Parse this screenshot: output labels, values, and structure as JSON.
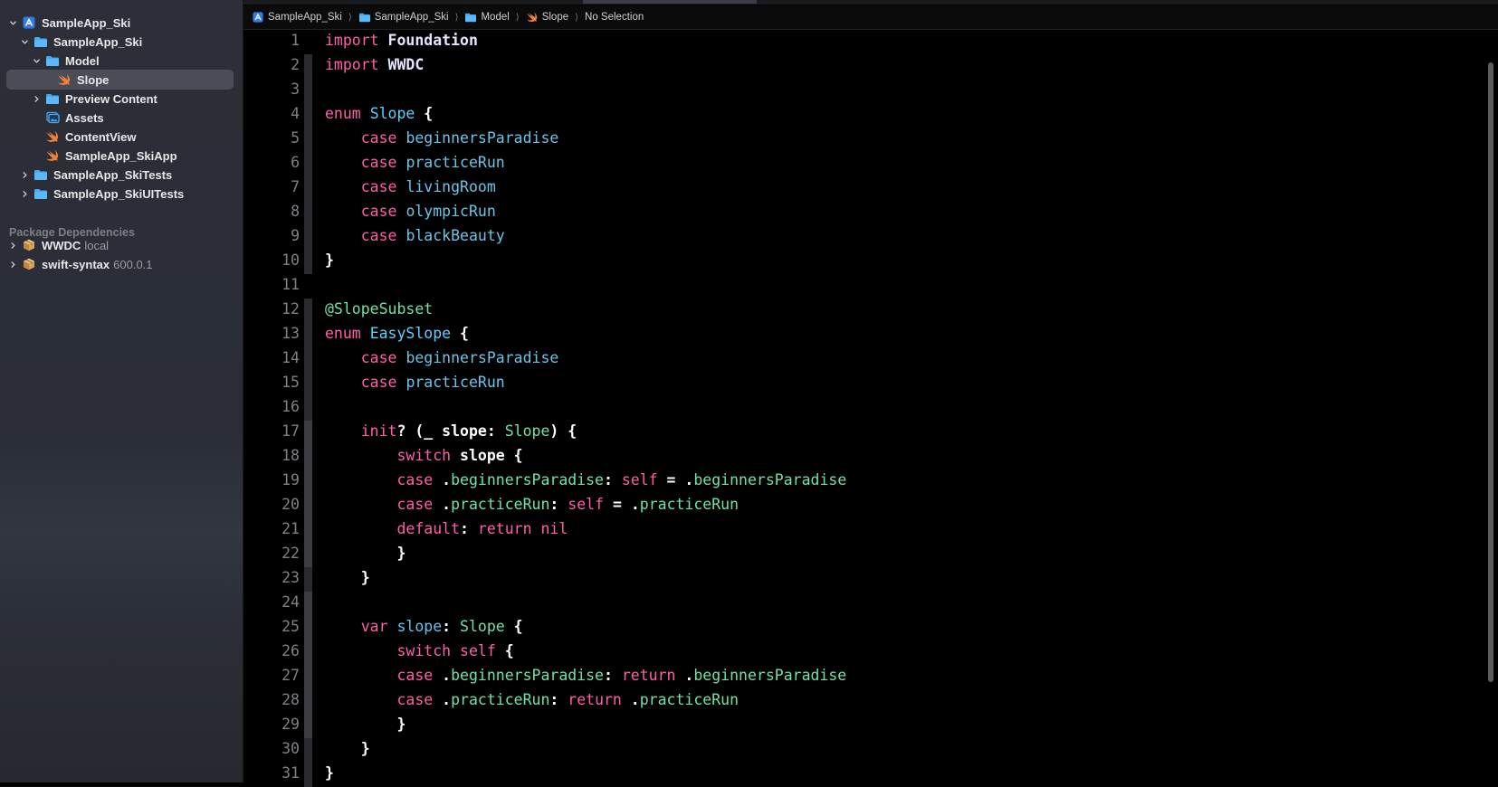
{
  "breadcrumb": {
    "items": [
      {
        "label": "SampleApp_Ski",
        "icon": "xcode-project-icon"
      },
      {
        "label": "SampleApp_Ski",
        "icon": "folder-icon"
      },
      {
        "label": "Model",
        "icon": "folder-icon"
      },
      {
        "label": "Slope",
        "icon": "swift-file-icon"
      },
      {
        "label": "No Selection",
        "icon": ""
      }
    ]
  },
  "navigator": {
    "tree": [
      {
        "label": "SampleApp_Ski",
        "icon": "xcode-project-icon",
        "disclosure": "expanded"
      },
      {
        "label": "SampleApp_Ski",
        "icon": "folder-icon",
        "disclosure": "expanded"
      },
      {
        "label": "Model",
        "icon": "folder-icon",
        "disclosure": "expanded"
      },
      {
        "label": "Slope",
        "icon": "swift-file-icon",
        "disclosure": "none",
        "selected": true
      },
      {
        "label": "Preview Content",
        "icon": "folder-icon",
        "disclosure": "collapsed"
      },
      {
        "label": "Assets",
        "icon": "asset-catalog-icon",
        "disclosure": "none"
      },
      {
        "label": "ContentView",
        "icon": "swift-file-icon",
        "disclosure": "none"
      },
      {
        "label": "SampleApp_SkiApp",
        "icon": "swift-file-icon",
        "disclosure": "none"
      },
      {
        "label": "SampleApp_SkiTests",
        "icon": "folder-icon",
        "disclosure": "collapsed"
      },
      {
        "label": "SampleApp_SkiUITests",
        "icon": "folder-icon",
        "disclosure": "collapsed"
      }
    ],
    "package_header": "Package Dependencies",
    "packages": [
      {
        "label": "WWDC",
        "detail": "local",
        "icon": "package-icon"
      },
      {
        "label": "swift-syntax",
        "detail": "600.0.1",
        "icon": "package-icon"
      }
    ]
  },
  "editor": {
    "line_numbers": [
      "1",
      "2",
      "3",
      "4",
      "5",
      "6",
      "7",
      "8",
      "9",
      "10",
      "11",
      "12",
      "13",
      "14",
      "15",
      "16",
      "17",
      "18",
      "19",
      "20",
      "21",
      "22",
      "23",
      "24",
      "25",
      "26",
      "27",
      "28",
      "29",
      "30",
      "31"
    ],
    "colors": {
      "keyword": "#ff5fa8",
      "type": "#5ed1ff",
      "member": "#6bc4e8",
      "attribute": "#6fe3a8"
    },
    "lines": [
      [
        {
          "t": "import",
          "c": "kw"
        },
        {
          "t": " "
        },
        {
          "t": "Foundation",
          "c": "lib"
        }
      ],
      [
        {
          "t": "import",
          "c": "kw"
        },
        {
          "t": " "
        },
        {
          "t": "WWDC",
          "c": "lib"
        }
      ],
      [],
      [
        {
          "t": "enum",
          "c": "kw"
        },
        {
          "t": " "
        },
        {
          "t": "Slope",
          "c": "ty"
        },
        {
          "t": " {"
        }
      ],
      [
        {
          "t": "    "
        },
        {
          "t": "case",
          "c": "kw"
        },
        {
          "t": " "
        },
        {
          "t": "beginnersParadise",
          "c": "mem"
        }
      ],
      [
        {
          "t": "    "
        },
        {
          "t": "case",
          "c": "kw"
        },
        {
          "t": " "
        },
        {
          "t": "practiceRun",
          "c": "mem"
        }
      ],
      [
        {
          "t": "    "
        },
        {
          "t": "case",
          "c": "kw"
        },
        {
          "t": " "
        },
        {
          "t": "livingRoom",
          "c": "mem"
        }
      ],
      [
        {
          "t": "    "
        },
        {
          "t": "case",
          "c": "kw"
        },
        {
          "t": " "
        },
        {
          "t": "olympicRun",
          "c": "mem"
        }
      ],
      [
        {
          "t": "    "
        },
        {
          "t": "case",
          "c": "kw"
        },
        {
          "t": " "
        },
        {
          "t": "blackBeauty",
          "c": "mem"
        }
      ],
      [
        {
          "t": "}"
        }
      ],
      [],
      [
        {
          "t": "@SlopeSubset",
          "c": "attr"
        }
      ],
      [
        {
          "t": "enum",
          "c": "kw"
        },
        {
          "t": " "
        },
        {
          "t": "EasySlope",
          "c": "ty"
        },
        {
          "t": " {"
        }
      ],
      [
        {
          "t": "    "
        },
        {
          "t": "case",
          "c": "kw"
        },
        {
          "t": " "
        },
        {
          "t": "beginnersParadise",
          "c": "mem"
        }
      ],
      [
        {
          "t": "    "
        },
        {
          "t": "case",
          "c": "kw"
        },
        {
          "t": " "
        },
        {
          "t": "practiceRun",
          "c": "mem"
        }
      ],
      [],
      [
        {
          "t": "    "
        },
        {
          "t": "init",
          "c": "kw"
        },
        {
          "t": "? (_ slope: "
        },
        {
          "t": "Slope",
          "c": "grn"
        },
        {
          "t": ") {"
        }
      ],
      [
        {
          "t": "        "
        },
        {
          "t": "switch",
          "c": "kw"
        },
        {
          "t": " slope {"
        }
      ],
      [
        {
          "t": "        "
        },
        {
          "t": "case",
          "c": "kw"
        },
        {
          "t": " ."
        },
        {
          "t": "beginnersParadise",
          "c": "grn"
        },
        {
          "t": ": "
        },
        {
          "t": "self",
          "c": "kw"
        },
        {
          "t": " = ."
        },
        {
          "t": "beginnersParadise",
          "c": "grn"
        }
      ],
      [
        {
          "t": "        "
        },
        {
          "t": "case",
          "c": "kw"
        },
        {
          "t": " ."
        },
        {
          "t": "practiceRun",
          "c": "grn"
        },
        {
          "t": ": "
        },
        {
          "t": "self",
          "c": "kw"
        },
        {
          "t": " = ."
        },
        {
          "t": "practiceRun",
          "c": "grn"
        }
      ],
      [
        {
          "t": "        "
        },
        {
          "t": "default",
          "c": "kw"
        },
        {
          "t": ": "
        },
        {
          "t": "return",
          "c": "kw"
        },
        {
          "t": " "
        },
        {
          "t": "nil",
          "c": "kw"
        }
      ],
      [
        {
          "t": "        }"
        }
      ],
      [
        {
          "t": "    }"
        }
      ],
      [],
      [
        {
          "t": "    "
        },
        {
          "t": "var",
          "c": "kw"
        },
        {
          "t": " "
        },
        {
          "t": "slope",
          "c": "mem"
        },
        {
          "t": ": "
        },
        {
          "t": "Slope",
          "c": "grn"
        },
        {
          "t": " {"
        }
      ],
      [
        {
          "t": "        "
        },
        {
          "t": "switch",
          "c": "kw"
        },
        {
          "t": " "
        },
        {
          "t": "self",
          "c": "kw"
        },
        {
          "t": " {"
        }
      ],
      [
        {
          "t": "        "
        },
        {
          "t": "case",
          "c": "kw"
        },
        {
          "t": " ."
        },
        {
          "t": "beginnersParadise",
          "c": "grn"
        },
        {
          "t": ": "
        },
        {
          "t": "return",
          "c": "kw"
        },
        {
          "t": " ."
        },
        {
          "t": "beginnersParadise",
          "c": "grn"
        }
      ],
      [
        {
          "t": "        "
        },
        {
          "t": "case",
          "c": "kw"
        },
        {
          "t": " ."
        },
        {
          "t": "practiceRun",
          "c": "grn"
        },
        {
          "t": ": "
        },
        {
          "t": "return",
          "c": "kw"
        },
        {
          "t": " ."
        },
        {
          "t": "practiceRun",
          "c": "grn"
        }
      ],
      [
        {
          "t": "        }"
        }
      ],
      [
        {
          "t": "    }"
        }
      ],
      [
        {
          "t": "}"
        }
      ]
    ]
  }
}
